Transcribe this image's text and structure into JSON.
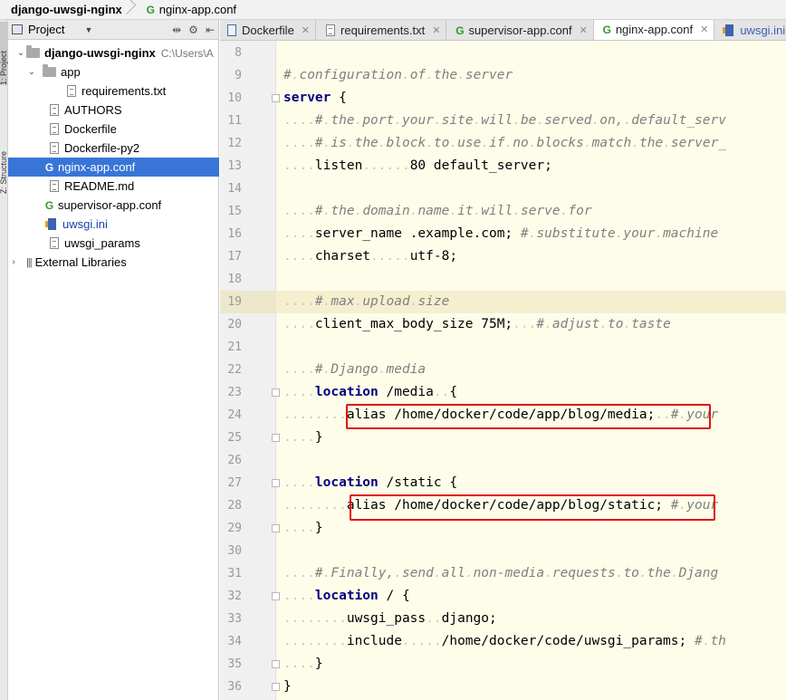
{
  "breadcrumb": {
    "project": "django-uwsgi-nginx",
    "file": "nginx-app.conf"
  },
  "toolstrip": {
    "tab1": "1: Project",
    "tab2": "Z: Structure"
  },
  "project_panel": {
    "title": "Project",
    "root_name": "django-uwsgi-nginx",
    "root_path": "C:\\Users\\A",
    "items": [
      {
        "label": "app",
        "type": "folder"
      },
      {
        "label": "requirements.txt",
        "type": "file"
      },
      {
        "label": "AUTHORS",
        "type": "file"
      },
      {
        "label": "Dockerfile",
        "type": "file"
      },
      {
        "label": "Dockerfile-py2",
        "type": "file"
      },
      {
        "label": "nginx-app.conf",
        "type": "conf"
      },
      {
        "label": "README.md",
        "type": "file"
      },
      {
        "label": "supervisor-app.conf",
        "type": "conf"
      },
      {
        "label": "uwsgi.ini",
        "type": "ini"
      },
      {
        "label": "uwsgi_params",
        "type": "file"
      },
      {
        "label": "External Libraries",
        "type": "library"
      }
    ]
  },
  "tabs": [
    {
      "label": "Dockerfile"
    },
    {
      "label": "requirements.txt"
    },
    {
      "label": "supervisor-app.conf"
    },
    {
      "label": "nginx-app.conf"
    },
    {
      "label": "uwsgi.ini"
    }
  ],
  "active_tab": "nginx-app.conf",
  "editor": {
    "current_line": 19,
    "lines": [
      {
        "n": "8",
        "text": ""
      },
      {
        "n": "9",
        "text": "# configuration of the server"
      },
      {
        "n": "10",
        "text": "server {"
      },
      {
        "n": "11",
        "text": "    # the port your site will be served on, default_serv"
      },
      {
        "n": "12",
        "text": "    # is the block to use if no blocks match the server_"
      },
      {
        "n": "13",
        "text": "    listen      80 default_server;"
      },
      {
        "n": "14",
        "text": ""
      },
      {
        "n": "15",
        "text": "    # the domain name it will serve for"
      },
      {
        "n": "16",
        "text": "    server_name .example.com; # substitute your machine"
      },
      {
        "n": "17",
        "text": "    charset     utf-8;"
      },
      {
        "n": "18",
        "text": ""
      },
      {
        "n": "19",
        "text": "    # max upload size"
      },
      {
        "n": "20",
        "text": "    client_max_body_size 75M;   # adjust to taste"
      },
      {
        "n": "21",
        "text": ""
      },
      {
        "n": "22",
        "text": "    # Django media"
      },
      {
        "n": "23",
        "text": "    location /media  {"
      },
      {
        "n": "24",
        "text": "        alias /home/docker/code/app/blog/media;  # your"
      },
      {
        "n": "25",
        "text": "    }"
      },
      {
        "n": "26",
        "text": ""
      },
      {
        "n": "27",
        "text": "    location /static {"
      },
      {
        "n": "28",
        "text": "        alias /home/docker/code/app/blog/static; # your"
      },
      {
        "n": "29",
        "text": "    }"
      },
      {
        "n": "30",
        "text": ""
      },
      {
        "n": "31",
        "text": "    # Finally, send all non-media requests to the Djang"
      },
      {
        "n": "32",
        "text": "    location / {"
      },
      {
        "n": "33",
        "text": "        uwsgi_pass  django;"
      },
      {
        "n": "34",
        "text": "        include     /home/docker/code/uwsgi_params; # th"
      },
      {
        "n": "35",
        "text": "    }"
      },
      {
        "n": "36",
        "text": "}"
      }
    ]
  },
  "colors": {
    "selection": "#3875d7",
    "highlight_box": "#e01010",
    "editor_bg": "#fdfde9",
    "keyword": "#000080",
    "comment": "#808080"
  }
}
